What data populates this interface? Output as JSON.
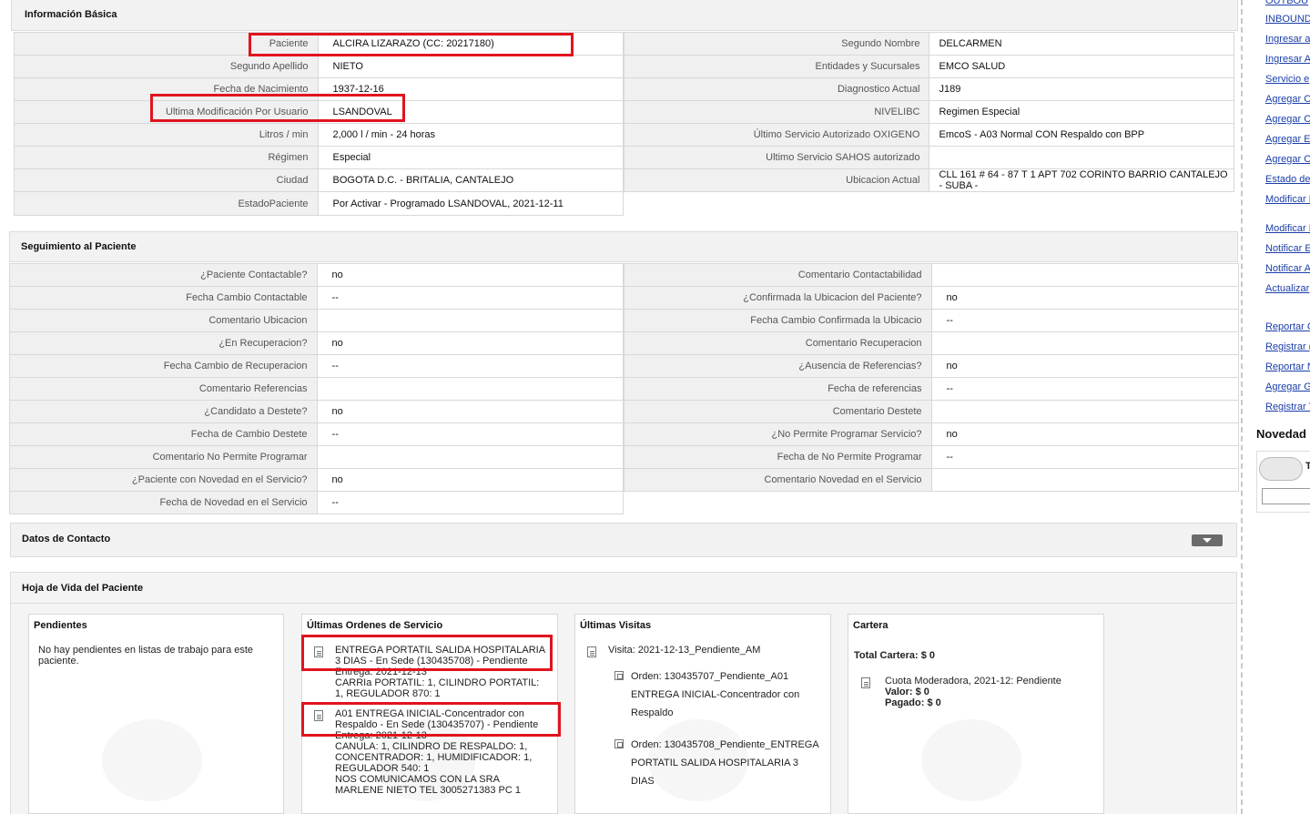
{
  "basic": {
    "title": "Información Básica",
    "left_rows": [
      {
        "label": "Paciente",
        "value": "ALCIRA LIZARAZO (CC: 20217180)"
      },
      {
        "label": "Segundo Apellido",
        "value": "NIETO"
      },
      {
        "label": "Fecha de Nacimiento",
        "value": "1937-12-16"
      },
      {
        "label": "Ultima Modificación Por Usuario",
        "value": "LSANDOVAL"
      },
      {
        "label": "Litros / min",
        "value": "2,000 l / min - 24 horas"
      },
      {
        "label": "Régimen",
        "value": "Especial"
      },
      {
        "label": "Ciudad",
        "value": "BOGOTA D.C. - BRITALIA, CANTALEJO"
      },
      {
        "label": "EstadoPaciente",
        "value": "Por Activar - Programado LSANDOVAL, 2021-12-11"
      }
    ],
    "right_rows": [
      {
        "label": "Segundo Nombre",
        "value": "DELCARMEN"
      },
      {
        "label": "Entidades y Sucursales",
        "value": "EMCO SALUD"
      },
      {
        "label": "Diagnostico Actual",
        "value": "J189"
      },
      {
        "label": "NIVELIBC",
        "value": "Regimen Especial"
      },
      {
        "label": "Último Servicio Autorizado OXIGENO",
        "value": "EmcoS - A03 Normal CON Respaldo con BPP"
      },
      {
        "label": "Ultimo Servicio SAHOS autorizado",
        "value": ""
      },
      {
        "label": "Ubicacion Actual",
        "value": "CLL 161 # 64 - 87 T 1 APT 702 CORINTO BARRIO CANTALEJO - SUBA -"
      }
    ]
  },
  "seguimiento": {
    "title": "Seguimiento al Paciente",
    "left_rows": [
      {
        "label": "¿Paciente Contactable?",
        "value": "no"
      },
      {
        "label": "Fecha Cambio Contactable",
        "value": "--"
      },
      {
        "label": "Comentario Ubicacion",
        "value": ""
      },
      {
        "label": "¿En Recuperacion?",
        "value": "no"
      },
      {
        "label": "Fecha Cambio de Recuperacion",
        "value": "--"
      },
      {
        "label": "Comentario Referencias",
        "value": ""
      },
      {
        "label": "¿Candidato a Destete?",
        "value": "no"
      },
      {
        "label": "Fecha de Cambio Destete",
        "value": "--"
      },
      {
        "label": "Comentario No Permite Programar",
        "value": ""
      },
      {
        "label": "¿Paciente con Novedad en el Servicio?",
        "value": "no"
      },
      {
        "label": "Fecha de Novedad en el Servicio",
        "value": "--"
      }
    ],
    "right_rows": [
      {
        "label": "Comentario Contactabilidad",
        "value": ""
      },
      {
        "label": "¿Confirmada la Ubicacion del Paciente?",
        "value": "no"
      },
      {
        "label": "Fecha Cambio Confirmada la Ubicacio",
        "value": "--"
      },
      {
        "label": "Comentario Recuperacion",
        "value": ""
      },
      {
        "label": "¿Ausencia de Referencias?",
        "value": "no"
      },
      {
        "label": "Fecha de referencias",
        "value": "--"
      },
      {
        "label": "Comentario Destete",
        "value": ""
      },
      {
        "label": "¿No Permite Programar Servicio?",
        "value": "no"
      },
      {
        "label": "Fecha de No Permite Programar",
        "value": "--"
      },
      {
        "label": "Comentario Novedad en el Servicio",
        "value": ""
      }
    ]
  },
  "contacto": {
    "title": "Datos de Contacto"
  },
  "hoja": {
    "title": "Hoja de Vida del Paciente",
    "pendientes": {
      "title": "Pendientes",
      "text": "No hay pendientes en listas de trabajo para este paciente."
    },
    "ordenes": {
      "title": "Últimas Ordenes de Servicio",
      "items": [
        {
          "line1": "ENTREGA PORTATIL SALIDA HOSPITALARIA",
          "line2": "3 DIAS - En Sede (130435708) - Pendiente",
          "line3": "Entrega: 2021-12-13",
          "line4": "CARRIa PORTATIL: 1, CILINDRO PORTATIL:",
          "line5": "1, REGULADOR 870: 1"
        },
        {
          "line1": "A01 ENTREGA INICIAL-Concentrador con",
          "line2": "Respaldo - En Sede (130435707) - Pendiente",
          "line3": "Entrega: 2021-12-13",
          "line4": "CANULA: 1, CILINDRO DE RESPALDO: 1,",
          "line5": "CONCENTRADOR: 1, HUMIDIFICADOR: 1,",
          "line6": "REGULADOR 540: 1",
          "line7": "NOS COMUNICAMOS CON LA SRA",
          "line8": "MARLENE NIETO TEL 3005271383 PC 1"
        }
      ]
    },
    "visitas": {
      "title": "Últimas Visitas",
      "visit": "Visita: 2021-12-13_Pendiente_AM",
      "orders": [
        {
          "l1": "Orden: 130435707_Pendiente_A01",
          "l2": "ENTREGA INICIAL-Concentrador con",
          "l3": "Respaldo"
        },
        {
          "l1": "Orden: 130435708_Pendiente_ENTREGA",
          "l2": "PORTATIL SALIDA HOSPITALARIA 3",
          "l3": "DIAS"
        }
      ]
    },
    "cartera": {
      "title": "Cartera",
      "total": "Total Cartera: $ 0",
      "cuota": "Cuota Moderadora, 2021-12: Pendiente",
      "valor": "Valor: $ 0",
      "pagado": "Pagado: $ 0"
    }
  },
  "sidebar": {
    "links": [
      "OUTBOU",
      "INBOUND",
      "Ingresar a",
      "Ingresar A",
      "Servicio e",
      "Agregar C",
      "Agregar C",
      "Agregar E",
      "Agregar O",
      "Estado de",
      "Modificar I",
      "Modificar I",
      "Notificar E",
      "Notificar A",
      "Actualizar",
      "Reportar C",
      "Registrar (",
      "Reportar N",
      "Agregar G",
      "Registrar T"
    ],
    "section_title": "Novedad",
    "cloud_label": "T"
  }
}
